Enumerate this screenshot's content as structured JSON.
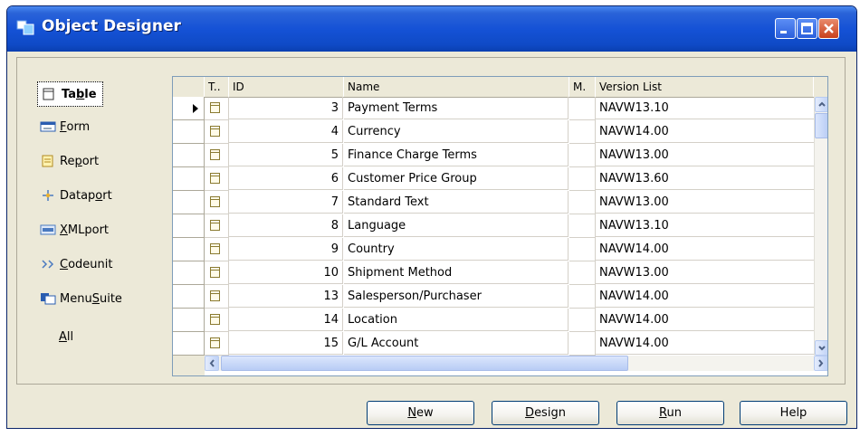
{
  "window": {
    "title": "Object Designer"
  },
  "types": [
    {
      "pre": "Ta",
      "ul": "b",
      "post": "le",
      "icon": "table-icon"
    },
    {
      "pre": "",
      "ul": "F",
      "post": "orm",
      "icon": "form-icon"
    },
    {
      "pre": "Re",
      "ul": "p",
      "post": "ort",
      "icon": "report-icon"
    },
    {
      "pre": "Datap",
      "ul": "o",
      "post": "rt",
      "icon": "dataport-icon"
    },
    {
      "pre": "",
      "ul": "X",
      "post": "MLport",
      "icon": "xmlport-icon"
    },
    {
      "pre": "",
      "ul": "C",
      "post": "odeunit",
      "icon": "codeunit-icon"
    },
    {
      "pre": "Menu",
      "ul": "S",
      "post": "uite",
      "icon": "menusuite-icon"
    },
    {
      "pre": "",
      "ul": "A",
      "post": "ll",
      "icon": ""
    }
  ],
  "grid": {
    "columns": [
      "T..",
      "ID",
      "Name",
      "M.",
      "Version List"
    ],
    "rows": [
      {
        "id": "3",
        "name": "Payment Terms",
        "version": "NAVW13.10"
      },
      {
        "id": "4",
        "name": "Currency",
        "version": "NAVW14.00"
      },
      {
        "id": "5",
        "name": "Finance Charge Terms",
        "version": "NAVW13.00"
      },
      {
        "id": "6",
        "name": "Customer Price Group",
        "version": "NAVW13.60"
      },
      {
        "id": "7",
        "name": "Standard Text",
        "version": "NAVW13.00"
      },
      {
        "id": "8",
        "name": "Language",
        "version": "NAVW13.10"
      },
      {
        "id": "9",
        "name": "Country",
        "version": "NAVW14.00"
      },
      {
        "id": "10",
        "name": "Shipment Method",
        "version": "NAVW13.00"
      },
      {
        "id": "13",
        "name": "Salesperson/Purchaser",
        "version": "NAVW14.00"
      },
      {
        "id": "14",
        "name": "Location",
        "version": "NAVW14.00"
      },
      {
        "id": "15",
        "name": "G/L Account",
        "version": "NAVW14.00"
      }
    ]
  },
  "buttons": {
    "new": {
      "ul": "N",
      "post": "ew"
    },
    "design": {
      "ul": "D",
      "post": "esign"
    },
    "run": {
      "ul": "R",
      "post": "un"
    },
    "help": {
      "ul": "",
      "post": "Help"
    }
  },
  "colors": {
    "titlebar": "#0f4ac6",
    "face": "#ece9d8",
    "close": "#c8401c"
  }
}
